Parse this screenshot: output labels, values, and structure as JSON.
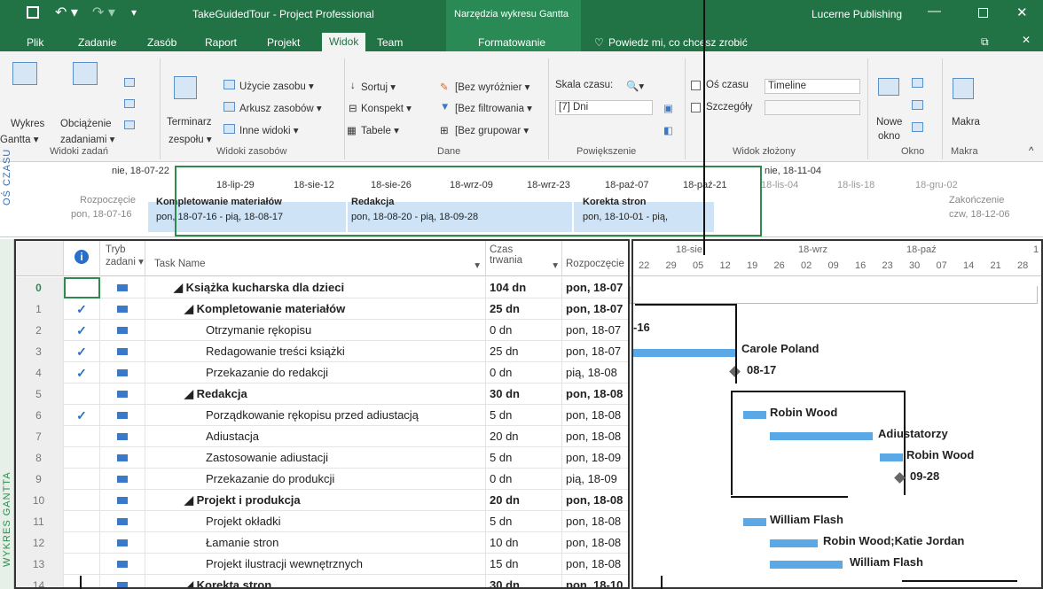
{
  "title": {
    "app": "TakeGuidedTour - Project Professional",
    "context": "Narzędzia wykresu Gantta",
    "company": "Lucerne Publishing"
  },
  "tabs": [
    "Plik",
    "Zadanie",
    "Zasób",
    "Raport",
    "Projekt",
    "Widok",
    "Team",
    "Formatowanie"
  ],
  "tellme": "Powiedz mi, co chcesz zrobić",
  "ribbon": {
    "gantt": [
      "Wykres",
      "Gantta ▾"
    ],
    "usage": [
      "Obciążenie",
      "zadaniami ▾"
    ],
    "team": [
      "Terminarz",
      "zespołu ▾"
    ],
    "res1": "Użycie zasobu ▾",
    "res2": "Arkusz zasobów ▾",
    "res3": "Inne widoki ▾",
    "sort": "Sortuj ▾",
    "outline": "Konspekt ▾",
    "tables": "Tabele ▾",
    "hl": "[Bez wyróżnier ▾",
    "flt": "[Bez filtrowania ▾",
    "grp": "[Bez grupowar ▾",
    "scale_lbl": "Skala czasu:",
    "scale_val": "[7] Dni",
    "tl_chk": "Oś czasu",
    "tl_val": "Timeline",
    "det_chk": "Szczegóły",
    "neww": [
      "Nowe",
      "okno"
    ],
    "macros": "Makra",
    "groups": [
      "Widoki zadań",
      "Widoki zasobów",
      "Dane",
      "Powiększenie",
      "Widok złożony",
      "Okno",
      "Makra"
    ]
  },
  "timeline": {
    "side": "OŚ CZASU",
    "top_left": "nie, 18-07-22",
    "top_right": "nie, 18-11-04",
    "ticks": [
      "18-lip-29",
      "18-sie-12",
      "18-sie-26",
      "18-wrz-09",
      "18-wrz-23",
      "18-paź-07",
      "18-paź-21",
      "18-lis-04",
      "18-lis-18",
      "18-gru-02"
    ],
    "start_lbl": "Rozpoczęcie",
    "start_date": "pon, 18-07-16",
    "end_lbl": "Zakończenie",
    "end_date": "czw, 18-12-06",
    "bars": [
      {
        "name": "Kompletowanie materiałów",
        "dates": "pon, 18-07-16 - pią, 18-08-17"
      },
      {
        "name": "Redakcja",
        "dates": "pon, 18-08-20 - pią, 18-09-28"
      },
      {
        "name": "Korekta stron",
        "dates": "pon, 18-10-01 - pią,"
      }
    ]
  },
  "grid": {
    "side": "WYKRES GANTTA",
    "headers": {
      "info": "i",
      "mode": [
        "Tryb",
        "zadani ▾"
      ],
      "name": "Task Name",
      "dur": [
        "Czas",
        "trwania"
      ],
      "start": "Rozpoczęcie"
    },
    "rows": [
      {
        "id": "0",
        "chk": "",
        "name": "◢ Książka kucharska dla dzieci",
        "dur": "104 dn",
        "start": "pon, 18-07",
        "lvl": 0,
        "bold": true
      },
      {
        "id": "1",
        "chk": "✓",
        "name": "◢ Kompletowanie materiałów",
        "dur": "25 dn",
        "start": "pon, 18-07",
        "lvl": 1,
        "bold": true
      },
      {
        "id": "2",
        "chk": "✓",
        "name": "Otrzymanie rękopisu",
        "dur": "0 dn",
        "start": "pon, 18-07",
        "lvl": 2,
        "bold": false
      },
      {
        "id": "3",
        "chk": "✓",
        "name": "Redagowanie treści książki",
        "dur": "25 dn",
        "start": "pon, 18-07",
        "lvl": 2,
        "bold": false
      },
      {
        "id": "4",
        "chk": "✓",
        "name": "Przekazanie do redakcji",
        "dur": "0 dn",
        "start": "pią, 18-08",
        "lvl": 2,
        "bold": false
      },
      {
        "id": "5",
        "chk": "",
        "name": "◢ Redakcja",
        "dur": "30 dn",
        "start": "pon, 18-08",
        "lvl": 1,
        "bold": true
      },
      {
        "id": "6",
        "chk": "✓",
        "name": "Porządkowanie rękopisu przed adiustacją",
        "dur": "5 dn",
        "start": "pon, 18-08",
        "lvl": 2,
        "bold": false
      },
      {
        "id": "7",
        "chk": "",
        "name": "Adiustacja",
        "dur": "20 dn",
        "start": "pon, 18-08",
        "lvl": 2,
        "bold": false
      },
      {
        "id": "8",
        "chk": "",
        "name": "Zastosowanie adiustacji",
        "dur": "5 dn",
        "start": "pon, 18-09",
        "lvl": 2,
        "bold": false
      },
      {
        "id": "9",
        "chk": "",
        "name": "Przekazanie do produkcji",
        "dur": "0 dn",
        "start": "pią, 18-09",
        "lvl": 2,
        "bold": false
      },
      {
        "id": "10",
        "chk": "",
        "name": "◢ Projekt i produkcja",
        "dur": "20 dn",
        "start": "pon, 18-08",
        "lvl": 1,
        "bold": true
      },
      {
        "id": "11",
        "chk": "",
        "name": "Projekt okładki",
        "dur": "5 dn",
        "start": "pon, 18-08",
        "lvl": 2,
        "bold": false
      },
      {
        "id": "12",
        "chk": "",
        "name": "Łamanie stron",
        "dur": "10 dn",
        "start": "pon, 18-08",
        "lvl": 2,
        "bold": false
      },
      {
        "id": "13",
        "chk": "",
        "name": "Projekt ilustracji wewnętrznych",
        "dur": "15 dn",
        "start": "pon, 18-08",
        "lvl": 2,
        "bold": false
      },
      {
        "id": "14",
        "chk": "",
        "name": "◢ Korekta stron",
        "dur": "30 dn",
        "start": "pon, 18-10",
        "lvl": 1,
        "bold": true
      }
    ]
  },
  "gantt": {
    "months": [
      "18-sie",
      "18-wrz",
      "18-paź",
      "1"
    ],
    "days": [
      "22",
      "29",
      "05",
      "12",
      "19",
      "26",
      "02",
      "09",
      "16",
      "23",
      "30",
      "07",
      "14",
      "21",
      "28"
    ],
    "labels": {
      "l16": "-16",
      "carole": "Carole Poland",
      "m0817": "08-17",
      "robin1": "Robin Wood",
      "adj": "Adiustatorzy",
      "robin2": "Robin Wood",
      "m0928": "09-28",
      "flash1": "William Flash",
      "rwkj": "Robin Wood;Katie Jordan",
      "flash2": "William Flash"
    }
  }
}
